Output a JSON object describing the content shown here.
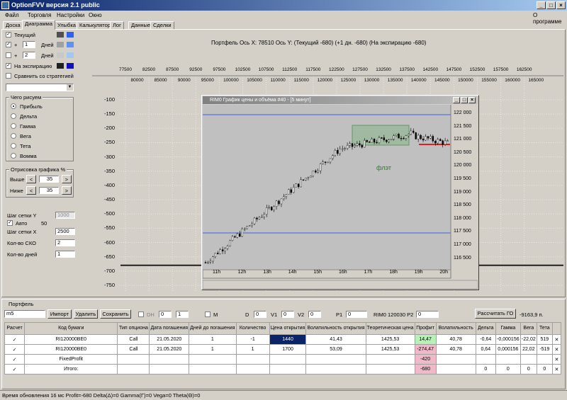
{
  "window": {
    "title": "OptionFVV версия 2.1 public"
  },
  "menu": {
    "items": [
      "Файл",
      "Торговля",
      "Настройки",
      "Окно"
    ],
    "about": "О программе"
  },
  "tabs": [
    "Доска",
    "Диаграмма",
    "Улыбка",
    "Калькулятор",
    "Лог",
    "Данные",
    "Сделки"
  ],
  "left": {
    "current_label": "Текущий",
    "plus": "+",
    "days_label": "Дней",
    "day1": "1",
    "day2": "2",
    "expiry_label": "На экспирацию",
    "compare_label": "Сравнить со стратегией",
    "what_draw": "Чего рисуем",
    "options": [
      "Прибыль",
      "Дельта",
      "Гамма",
      "Вега",
      "Тета",
      "Вомма"
    ],
    "range_title": "Отрисовка графика %",
    "above": "Выше",
    "below": "Ниже",
    "above_val": "35",
    "below_val": "35",
    "step_y": "Шаг сетки Y",
    "step_y_val": "1000",
    "auto": "Авто",
    "auto_val": "50",
    "step_x": "Шаг сетки X",
    "step_x_val": "2500",
    "sko": "Кол-во СКО",
    "sko_val": "2",
    "days": "Кол-во дней",
    "days_val": "1",
    "lt": "<",
    "gt": ">"
  },
  "chart_header": "Портфель  Ось X: 78510  Ось Y:  (Текущий -680)  (+1 дн. -680)  (На экспирацию -680)",
  "chart_data": {
    "type": "line",
    "x_ticks_top": [
      "77500",
      "82500",
      "87500",
      "92500",
      "97500",
      "102500",
      "107500",
      "112500",
      "117500",
      "122500",
      "127500",
      "132500",
      "137500",
      "142500",
      "147500",
      "152500",
      "157500",
      "162500"
    ],
    "x_ticks_bottom": [
      "80000",
      "85000",
      "90000",
      "95000",
      "100000",
      "105000",
      "110000",
      "115000",
      "120000",
      "125000",
      "130000",
      "135000",
      "140000",
      "145000",
      "150000",
      "155000",
      "160000",
      "165000"
    ],
    "y_ticks": [
      "-100",
      "-150",
      "-200",
      "-250",
      "-300",
      "-350",
      "-400",
      "-450",
      "-500",
      "-550",
      "-600",
      "-650",
      "-700",
      "-750"
    ],
    "series": [
      {
        "values": [
          -680,
          -680
        ]
      }
    ]
  },
  "popup": {
    "title": "RIM0 График цены и объёма #40 - [5 минут]",
    "flat_label": "флэт",
    "price_ticks": [
      "122 000",
      "121 500",
      "121 000",
      "120 500",
      "120 000",
      "119 500",
      "119 000",
      "118 500",
      "118 000",
      "117 500",
      "117 000",
      "116 500"
    ],
    "time_ticks": [
      "11h",
      "12h",
      "13h",
      "14h",
      "15h",
      "16h",
      "17h",
      "18h",
      "19h",
      "20h"
    ]
  },
  "portfolio": {
    "title": "Портфель",
    "combo": "m5",
    "import": "Импорт",
    "delete": "Удалить",
    "save": "Сохранить",
    "dh": "DH",
    "dh1": "0",
    "dh2": "1",
    "m": "M",
    "d": "D",
    "d_val": "0",
    "v1": "V1",
    "v1_val": "0",
    "v2": "V2",
    "v2_val": "0",
    "p1": "P1",
    "p1_val": "0",
    "p2_label": "RIM0 120030  P2",
    "p2_val": "0",
    "calc_go": "Рассчитать ГО",
    "go_val": "-9163,9 п.",
    "headers": [
      "Расчет",
      "Код бумаги",
      "Тип опциона",
      "Дата погашения",
      "Дней до погашения",
      "Количество",
      "Цена открытия",
      "Волатильность открытия",
      "Теоретическая цена",
      "Профит",
      "Волатильность",
      "Дельта",
      "Гамма",
      "Вега",
      "Тета",
      ""
    ],
    "rows": [
      [
        "✓",
        "RI120000BE0",
        "Call",
        "21.05.2020",
        "1",
        "-1",
        "1440",
        "41,43",
        "1425,53",
        "14,47",
        "40,78",
        "-0,64",
        "-0,000156",
        "-22,02",
        "519",
        "✕"
      ],
      [
        "✓",
        "RI120000BE0",
        "Call",
        "21.05.2020",
        "1",
        "1",
        "1700",
        "53,09",
        "1425,53",
        "-274,47",
        "40,78",
        "0,64",
        "0,000156",
        "22,02",
        "-519",
        "✕"
      ],
      [
        "✓",
        "FixedProfit",
        "",
        "",
        "",
        "",
        "",
        "",
        "",
        "-420",
        "",
        "",
        "",
        "",
        "",
        "✕"
      ],
      [
        "✓",
        "Итого:",
        "",
        "",
        "",
        "",
        "",
        "",
        "",
        "-680",
        "",
        "0",
        "0",
        "0",
        "0",
        "✕"
      ]
    ]
  },
  "status": "Время обновления 16 мс  Profit=-680 Delta(Δ)=0 Gamma(Γ)=0 Vega=0 Theta(Θ)=0",
  "colors": {
    "title_bar": "#0a246a",
    "profit_pos": "#b8f0b8",
    "profit_neg": "#f0b8c8",
    "highlight_cell": "#0a246a",
    "flat_box": "#8ab48a"
  }
}
